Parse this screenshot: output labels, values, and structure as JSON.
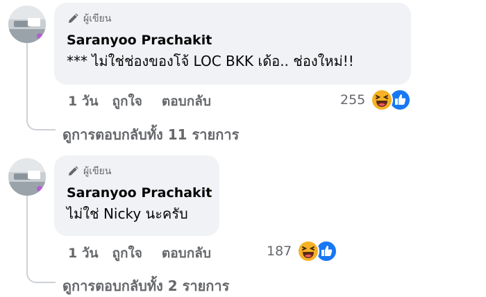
{
  "comments": [
    {
      "author_badge": "ผู้เขียน",
      "author": "Saranyoo Prachakit",
      "text": "*** ไม่ใช่ช่องของโจ้ LOC BKK เด้อ.. ช่องใหม่!!",
      "time": "1 วัน",
      "like_label": "ถูกใจ",
      "reply_label": "ตอบกลับ",
      "reaction_count": "255",
      "reaction_icons": [
        "haha-icon",
        "like-icon"
      ],
      "view_replies": "ดูการตอบกลับทั้ง 11 รายการ"
    },
    {
      "author_badge": "ผู้เขียน",
      "author": "Saranyoo Prachakit",
      "text": "ไม่ใช่ Nicky นะครับ",
      "time": "1 วัน",
      "like_label": "ถูกใจ",
      "reply_label": "ตอบกลับ",
      "reaction_count": "187",
      "reaction_icons": [
        "haha-icon",
        "like-icon"
      ],
      "view_replies": "ดูการตอบกลับทั้ง 2 รายการ"
    }
  ],
  "colors": {
    "bubble": "#f0f2f5",
    "secondary_text": "#65676b",
    "like_blue": "#1877f2",
    "haha_yellow": "#f7b125"
  }
}
